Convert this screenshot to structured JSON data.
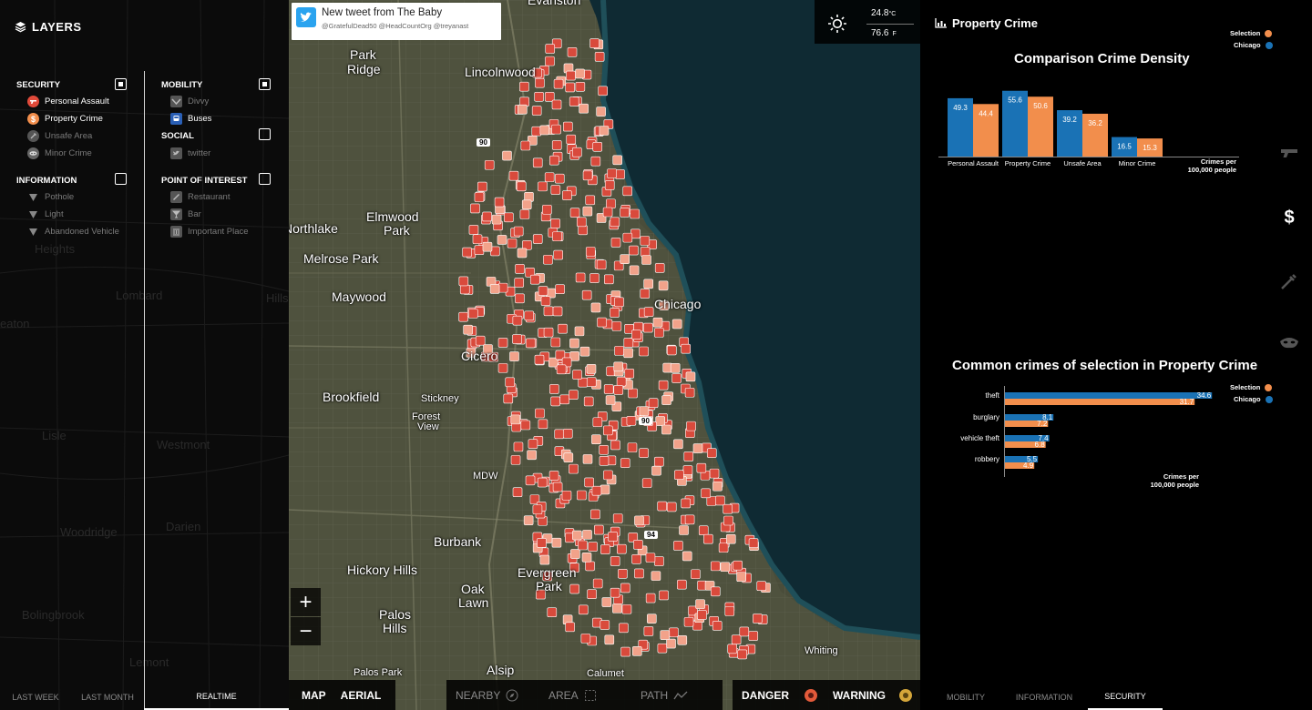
{
  "left_panel": {
    "title": "LAYERS",
    "sections": {
      "security": {
        "title": "SECURITY",
        "checked": true,
        "items": [
          {
            "label": "Personal Assault",
            "icon": "gun-icon",
            "active": true
          },
          {
            "label": "Property Crime",
            "icon": "dollar-icon",
            "active": true
          },
          {
            "label": "Unsafe Area",
            "icon": "syringe-icon",
            "active": false
          },
          {
            "label": "Minor Crime",
            "icon": "mask-icon",
            "active": false
          }
        ]
      },
      "information": {
        "title": "INFORMATION",
        "checked": false,
        "items": [
          {
            "label": "Pothole",
            "icon": "pothole-icon",
            "active": false
          },
          {
            "label": "Light",
            "icon": "light-icon",
            "active": false
          },
          {
            "label": "Abandoned Vehicle",
            "icon": "vehicle-icon",
            "active": false
          }
        ]
      },
      "mobility": {
        "title": "MOBILITY",
        "checked": true,
        "items": [
          {
            "label": "Divvy",
            "icon": "bike-icon",
            "active": false
          },
          {
            "label": "Buses",
            "icon": "bus-icon",
            "active": true
          }
        ]
      },
      "social": {
        "title": "SOCIAL",
        "checked": false,
        "items": [
          {
            "label": "twitter",
            "icon": "twitter-icon",
            "active": false
          }
        ]
      },
      "point_of_interest": {
        "title": "POINT OF INTEREST",
        "checked": false,
        "items": [
          {
            "label": "Restaurant",
            "icon": "restaurant-icon",
            "active": false
          },
          {
            "label": "Bar",
            "icon": "bar-icon",
            "active": false
          },
          {
            "label": "Important Place",
            "icon": "landmark-icon",
            "active": false
          }
        ]
      }
    },
    "background_places": [
      "Heights",
      "Lombard",
      "eaton",
      "Lisle",
      "Westmont",
      "Woodridge",
      "Darien",
      "Bolingbrook",
      "Lemont",
      "Hillside"
    ],
    "bottom_tabs": [
      {
        "label": "LAST WEEK",
        "active": false
      },
      {
        "label": "LAST MONTH",
        "active": false
      },
      {
        "label": "REALTIME",
        "active": true
      }
    ]
  },
  "map": {
    "tweet": {
      "title": "New tweet from The Baby",
      "handles": "@GratefulDead50 @HeadCountOrg @treyanast"
    },
    "weather": {
      "celsius": "24.8",
      "celsius_unit": "°C",
      "fahrenheit": "76.6",
      "fahrenheit_unit": "F",
      "icon": "sun-icon"
    },
    "places": [
      {
        "name": "Evanston",
        "cls": "",
        "x": 262,
        "y": -8
      },
      {
        "name": "Park",
        "cls": "",
        "x": 67,
        "y": 52
      },
      {
        "name": "Ridge",
        "cls": "",
        "x": 64,
        "y": 68
      },
      {
        "name": "Lincolnwood",
        "cls": "",
        "x": 193,
        "y": 71
      },
      {
        "name": "Elmwood",
        "cls": "",
        "x": 85,
        "y": 230
      },
      {
        "name": "Park",
        "cls": "",
        "x": 104,
        "y": 245
      },
      {
        "name": "Northlake",
        "cls": "",
        "x": -6,
        "y": 243
      },
      {
        "name": "Melrose Park",
        "cls": "",
        "x": 16,
        "y": 276
      },
      {
        "name": "Maywood",
        "cls": "",
        "x": 47,
        "y": 318
      },
      {
        "name": "Chicago",
        "cls": "",
        "x": 401,
        "y": 326
      },
      {
        "name": "Cicero",
        "cls": "",
        "x": 189,
        "y": 383
      },
      {
        "name": "Brookfield",
        "cls": "",
        "x": 37,
        "y": 428
      },
      {
        "name": "Stickney",
        "cls": "small",
        "x": 145,
        "y": 432
      },
      {
        "name": "Forest",
        "cls": "small",
        "x": 135,
        "y": 452
      },
      {
        "name": "View",
        "cls": "small",
        "x": 141,
        "y": 463
      },
      {
        "name": "MDW",
        "cls": "small",
        "x": 202,
        "y": 517
      },
      {
        "name": "Burbank",
        "cls": "",
        "x": 159,
        "y": 587
      },
      {
        "name": "Hickory Hills",
        "cls": "",
        "x": 64,
        "y": 618
      },
      {
        "name": "Oak",
        "cls": "",
        "x": 189,
        "y": 639
      },
      {
        "name": "Lawn",
        "cls": "",
        "x": 186,
        "y": 654
      },
      {
        "name": "Evergreen",
        "cls": "",
        "x": 251,
        "y": 621
      },
      {
        "name": "Park",
        "cls": "",
        "x": 271,
        "y": 636
      },
      {
        "name": "Palos",
        "cls": "",
        "x": 99,
        "y": 667
      },
      {
        "name": "Hills",
        "cls": "",
        "x": 103,
        "y": 682
      },
      {
        "name": "Alsip",
        "cls": "",
        "x": 217,
        "y": 728
      },
      {
        "name": "Palos Park",
        "cls": "small",
        "x": 71,
        "y": 733
      },
      {
        "name": "Calumet",
        "cls": "small",
        "x": 327,
        "y": 734
      },
      {
        "name": "Whiting",
        "cls": "small",
        "x": 566,
        "y": 709
      }
    ],
    "highway_shields": [
      {
        "num": "90",
        "x": 206,
        "y": 152
      },
      {
        "num": "90",
        "x": 384,
        "y": 458
      },
      {
        "num": "94",
        "x": 390,
        "y": 583
      }
    ],
    "zoom_in": "+",
    "zoom_out": "−",
    "map_type": {
      "map": "MAP",
      "aerial": "AERIAL"
    },
    "filters": [
      {
        "label": "NEARBY",
        "icon": "compass-icon"
      },
      {
        "label": "AREA",
        "icon": "area-icon"
      },
      {
        "label": "PATH",
        "icon": "path-icon"
      }
    ],
    "status": {
      "danger": "DANGER",
      "warning": "WARNING",
      "danger_color": "#e35a3a",
      "warning_color": "#d4a63a"
    }
  },
  "right_panel": {
    "title": "Property Crime",
    "colors": {
      "selection": "#f28e4c",
      "chicago": "#1a72b5"
    },
    "legend": {
      "selection": "Selection",
      "chicago": "Chicago"
    },
    "chart_data": [
      {
        "type": "bar",
        "title": "Comparison Crime Density",
        "categories": [
          "Personal Assault",
          "Property Crime",
          "Unsafe Area",
          "Minor Crime"
        ],
        "series": [
          {
            "name": "Chicago",
            "values": [
              49.3,
              55.6,
              39.2,
              16.5
            ]
          },
          {
            "name": "Selection",
            "values": [
              44.4,
              50.6,
              36.2,
              15.3
            ]
          }
        ],
        "ylabel": "Crimes per 100,000 people",
        "ylim": [
          0,
          60
        ],
        "legend": "top-right"
      },
      {
        "type": "bar",
        "orientation": "horizontal",
        "title": "Common crimes of selection in Property Crime",
        "categories": [
          "theft",
          "burglary",
          "vehicle theft",
          "robbery"
        ],
        "series": [
          {
            "name": "Chicago",
            "values": [
              34.6,
              8.1,
              7.4,
              5.5
            ]
          },
          {
            "name": "Selection",
            "values": [
              31.7,
              7.2,
              6.8,
              4.9
            ]
          }
        ],
        "xlabel": "Crimes per 100,000 people",
        "xlim": [
          0,
          37
        ],
        "legend": "top-right"
      }
    ],
    "side_icons": [
      "gun-icon",
      "dollar-icon",
      "syringe-icon",
      "mask-icon"
    ],
    "bottom_tabs": [
      {
        "label": "MOBILITY",
        "active": false
      },
      {
        "label": "INFORMATION",
        "active": false
      },
      {
        "label": "SECURITY",
        "active": true
      }
    ]
  }
}
